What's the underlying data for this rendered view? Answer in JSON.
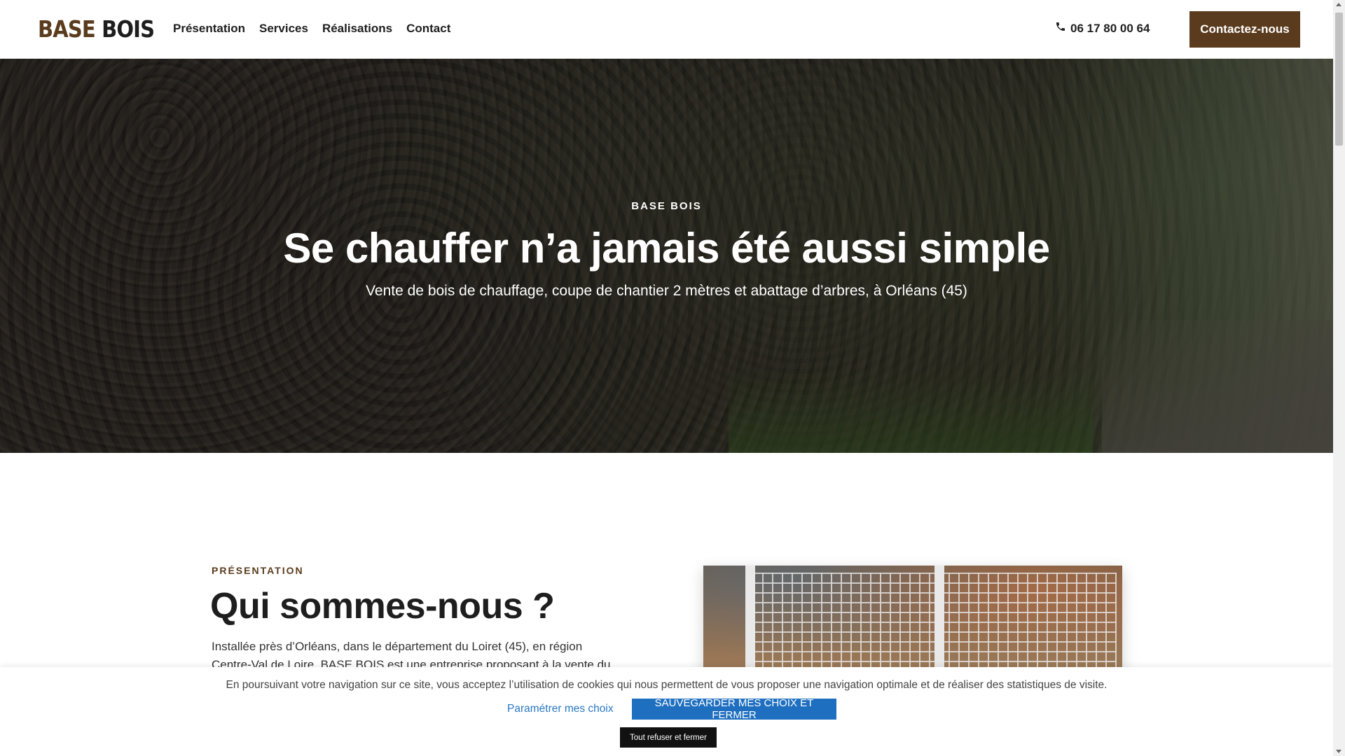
{
  "header": {
    "logo_part1": "BASE",
    "logo_part2": "BOIS",
    "nav": [
      "Présentation",
      "Services",
      "Réalisations",
      "Contact"
    ],
    "phone": "06 17 80 00 64",
    "cta": "Contactez-nous",
    "brand_color": "#5a3b1d"
  },
  "hero": {
    "eyebrow": "BASE BOIS",
    "title": "Se chauffer n’a jamais été aussi simple",
    "subtitle": "Vente de bois de chauffage, coupe de chantier 2 mètres et abattage d’arbres, à Orléans (45)"
  },
  "about": {
    "eyebrow": "PRÉSENTATION",
    "title": "Qui sommes-nous ?",
    "text_line1": "Installée près d’Orléans, dans le département du Loiret (45), en région",
    "text_line2": "Centre-Val de Loire. BASE BOIS est une entreprise proposant à la vente du"
  },
  "cookie": {
    "text": "En poursuivant votre navigation sur ce site, vous acceptez l’utilisation de cookies qui nous permettent de vous proposer une navigation optimale et de réaliser des statistiques de visite.",
    "config_label": "Paramétrer mes choix",
    "save_label": "SAUVEGARDER MES CHOIX ET FERMER",
    "refuse_label": "Tout refuser et fermer",
    "save_color": "#1f6fc0"
  }
}
